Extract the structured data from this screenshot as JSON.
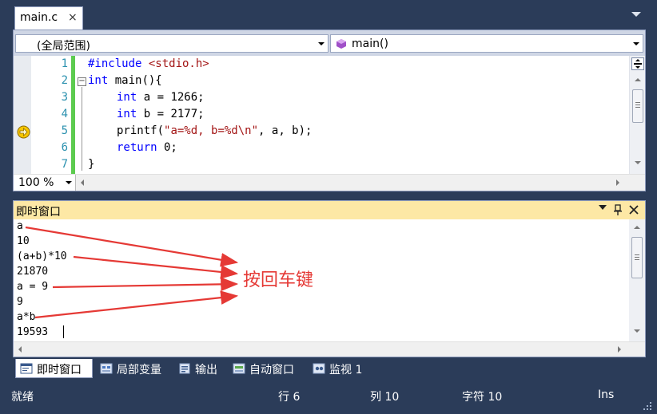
{
  "document_tab": {
    "title": "main.c",
    "close": "×"
  },
  "navbar": {
    "scope": "(全局范围)",
    "function": "main()"
  },
  "code": {
    "line_numbers": [
      "1",
      "2",
      "3",
      "4",
      "5",
      "6",
      "7"
    ],
    "lines": [
      {
        "kw": "",
        "text": "#include <stdio.h>"
      },
      {
        "kw": "int",
        "text": " main(){"
      },
      {
        "kw": "int",
        "text": " a = 1266;"
      },
      {
        "kw": "int",
        "text": " b = 2177;"
      },
      {
        "kw": "",
        "text": "printf(\"a=%d, b=%d\\n\", a, b);"
      },
      {
        "kw": "return",
        "text": " 0;"
      },
      {
        "kw": "",
        "text": "}"
      }
    ],
    "current_line": 5
  },
  "editor_footer": {
    "zoom": "100 %"
  },
  "immediate": {
    "title": "即时窗口",
    "lines": [
      "a",
      "10",
      "(a+b)*10",
      "21870",
      "a = 9",
      "9",
      "a*b",
      "19593"
    ],
    "annotation": "按回车键"
  },
  "tool_tabs": [
    {
      "label": "即时窗口",
      "active": true
    },
    {
      "label": "局部变量",
      "active": false
    },
    {
      "label": "输出",
      "active": false
    },
    {
      "label": "自动窗口",
      "active": false
    },
    {
      "label": "监视 1",
      "active": false
    }
  ],
  "status": {
    "ready": "就绪",
    "row": "行 6",
    "col": "列 10",
    "char": "字符 10",
    "mode": "Ins"
  },
  "colors": {
    "chrome": "#2b3c59",
    "keyword": "#0000ff",
    "string": "#a31515",
    "line_number": "#2b91af",
    "changed_bar": "#5ccb4f",
    "annotation": "#e53935",
    "immediate_header": "#fde8a5"
  }
}
